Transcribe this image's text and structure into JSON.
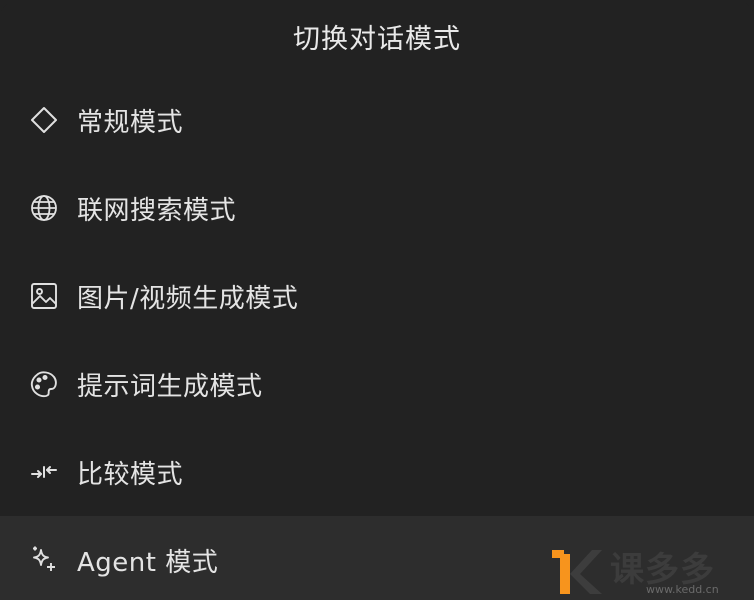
{
  "header": {
    "title": "切换对话模式"
  },
  "menu": {
    "items": [
      {
        "label": "常规模式",
        "icon": "diamond-icon",
        "active": false
      },
      {
        "label": "联网搜索模式",
        "icon": "globe-icon",
        "active": false
      },
      {
        "label": "图片/视频生成模式",
        "icon": "image-icon",
        "active": false
      },
      {
        "label": "提示词生成模式",
        "icon": "palette-icon",
        "active": false
      },
      {
        "label": "比较模式",
        "icon": "compare-arrows-icon",
        "active": false
      },
      {
        "label": "Agent 模式",
        "icon": "sparkles-icon",
        "active": true
      }
    ]
  },
  "watermark": {
    "brand": "课多多",
    "url": "www.kedd.cn"
  },
  "colors": {
    "background": "#222222",
    "active_row": "#2d2d2d",
    "text": "#e4e4e4",
    "watermark_orange": "#f7941d"
  }
}
